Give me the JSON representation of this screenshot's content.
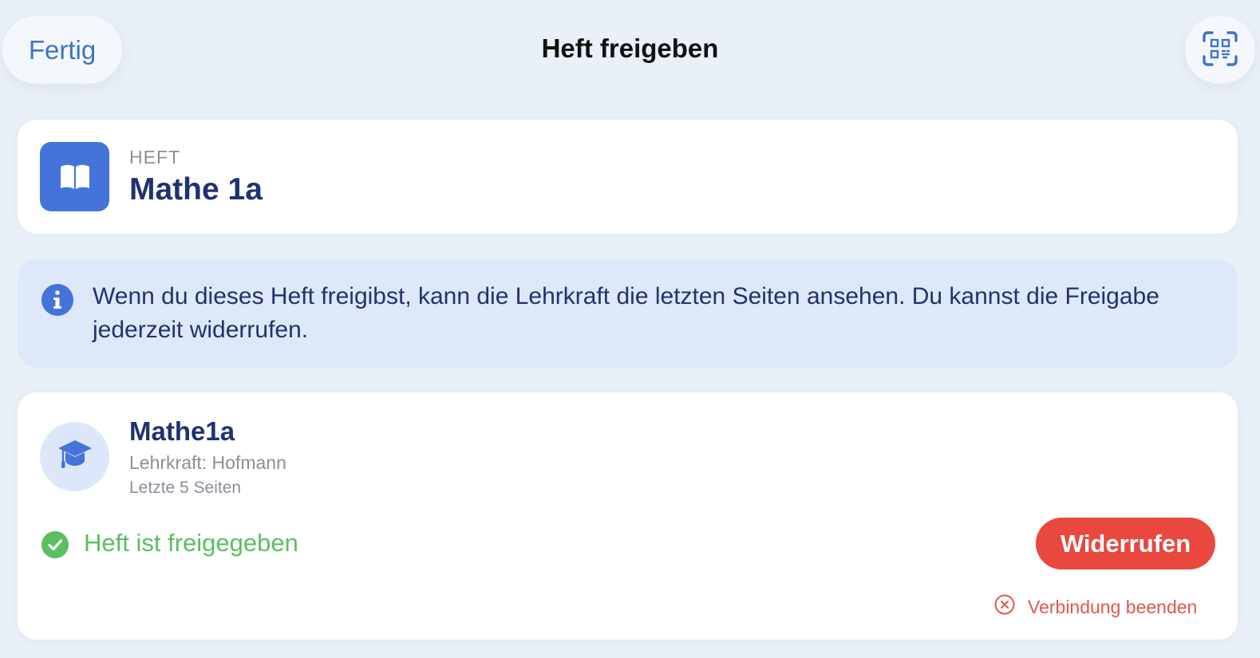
{
  "header": {
    "done_label": "Fertig",
    "title": "Heft freigeben",
    "qr_icon": "qr-scan-icon"
  },
  "heft": {
    "label": "HEFT",
    "name": "Mathe 1a",
    "icon": "book-icon"
  },
  "info": {
    "icon": "info-icon",
    "text": "Wenn du dieses Heft freigibst, kann die Lehrkraft die letzten Seiten ansehen. Du kannst die Freigabe jederzeit widerrufen."
  },
  "class": {
    "name": "Mathe1a",
    "teacher": "Lehrkraft: Hofmann",
    "pages": "Letzte 5 Seiten",
    "icon": "graduation-cap-icon",
    "status": "Heft ist freigegeben",
    "status_icon": "checkmark-circle-icon",
    "revoke_label": "Widerrufen",
    "end_connection_label": "Verbindung beenden",
    "end_icon": "x-circle-icon"
  },
  "colors": {
    "accent": "#4474d9",
    "success": "#5bbf5f",
    "danger": "#e9483f",
    "background": "#eaf0f8",
    "info_bg": "#dde8f8"
  }
}
